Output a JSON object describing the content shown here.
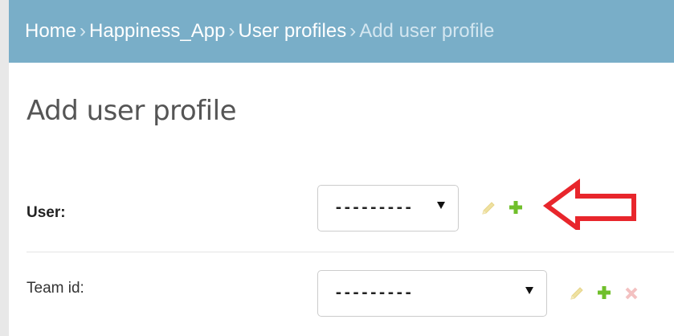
{
  "breadcrumbs": {
    "home": "Home",
    "app": "Happiness_App",
    "model": "User profiles",
    "current": "Add user profile",
    "separator": "›"
  },
  "page": {
    "title": "Add user profile"
  },
  "form": {
    "user": {
      "label": "User:",
      "selected": "---------"
    },
    "team": {
      "label": "Team id:",
      "selected": "---------"
    }
  },
  "icons": {
    "edit": "pencil-icon",
    "add": "plus-icon",
    "delete": "x-icon",
    "annotation": "red-arrow-icon"
  },
  "colors": {
    "breadcrumb_bg": "#79aec8",
    "add_green": "#70bf2b",
    "edit_yellow": "#efe1a0",
    "delete_pink": "#f3c1c1",
    "annotation_red": "#e8262c"
  }
}
